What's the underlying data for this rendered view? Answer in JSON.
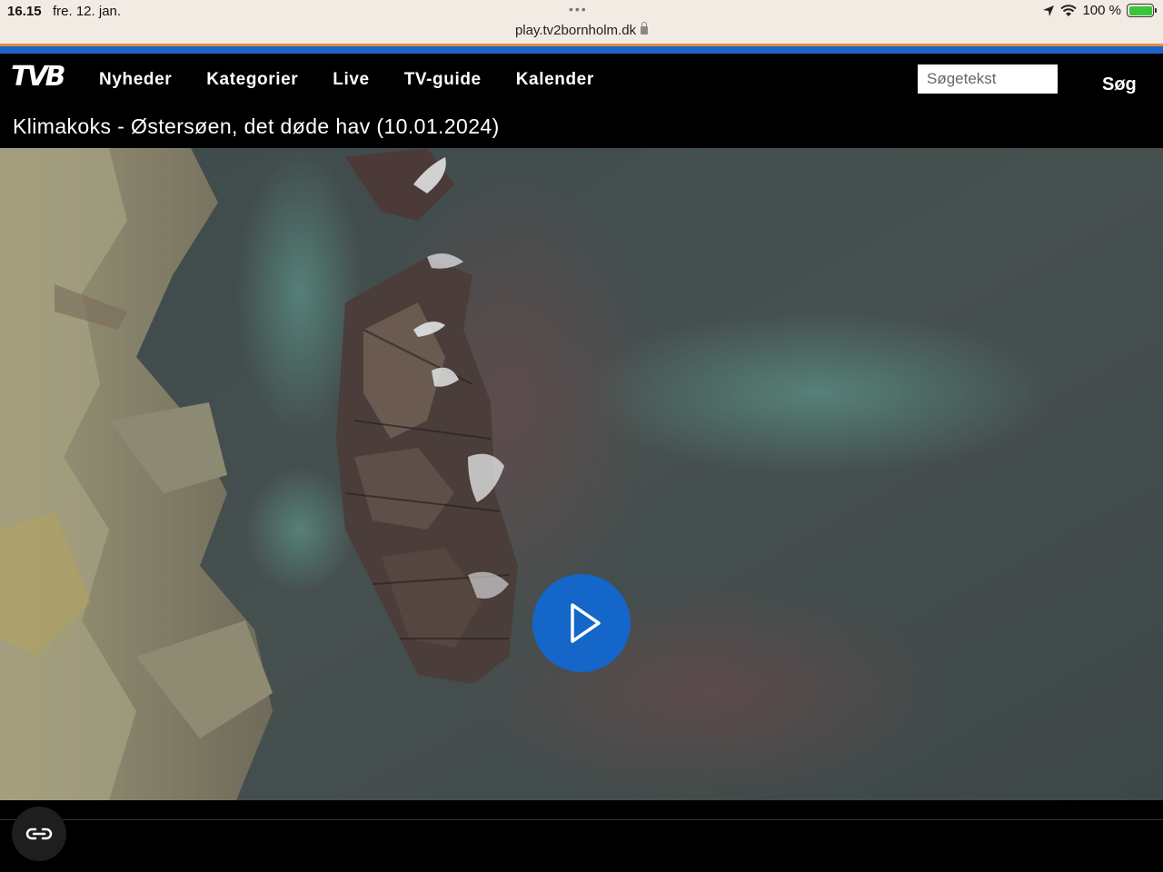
{
  "status_bar": {
    "time": "16.15",
    "date": "fre. 12. jan.",
    "url": "play.tv2bornholm.dk",
    "battery": "100 %"
  },
  "header": {
    "logo_text": "TVB",
    "nav": [
      "Nyheder",
      "Kategorier",
      "Live",
      "TV-guide",
      "Kalender"
    ],
    "search_placeholder": "Søgetekst",
    "search_button": "Søg"
  },
  "video": {
    "title": "Klimakoks - Østersøen, det døde hav (10.01.2024)",
    "state": "paused"
  },
  "icons": {
    "play": "play-icon",
    "reader": "reader-mode-icon",
    "location": "location-arrow-icon",
    "wifi": "wifi-icon",
    "battery": "battery-charging-icon",
    "lock": "lock-icon"
  },
  "colors": {
    "accent_blue": "#1d64c8",
    "accent_orange": "#e08a3c",
    "play_button": "#1466c8",
    "header_bg": "#000000"
  }
}
